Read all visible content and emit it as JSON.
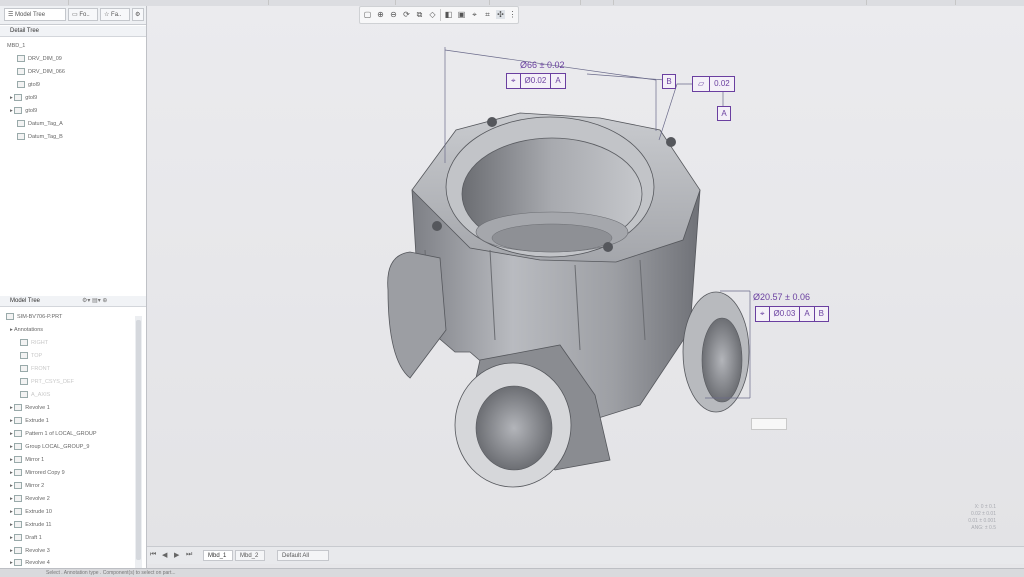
{
  "tabs": {
    "model_tree": "Model Tree",
    "folder": "Fo..",
    "favorites": "Fa.."
  },
  "detail_tree": {
    "header": "Detail Tree",
    "items": [
      "MBD_1",
      "DRV_DIM_09",
      "DRV_DIM_066",
      "gtol9",
      "gtol9",
      "gtol9",
      "Datum_Tag_A",
      "Datum_Tag_B"
    ]
  },
  "model_tree": {
    "header": "Model Tree",
    "items": [
      "SIM-BV706-P.PRT",
      "Annotations",
      "RIGHT",
      "TOP",
      "FRONT",
      "PRT_CSYS_DEF",
      "A_AXIS",
      "Revolve 1",
      "Extrude 1",
      "Pattern 1 of LOCAL_GROUP",
      "Group LOCAL_GROUP_9",
      "Mirror 1",
      "Mirrored Copy 9",
      "Mirror 2",
      "Revolve 2",
      "Extrude 10",
      "Extrude 11",
      "Draft 1",
      "Revolve 3",
      "Revolve 4"
    ]
  },
  "annotations": {
    "dim_top": "Ø66 ± 0.02",
    "fcf_top_value": "Ø0.02",
    "fcf_top_datum": "A",
    "datum_b": "B",
    "flatness_value": "0.02",
    "datum_a": "A",
    "dim_right": "Ø20.57 ± 0.06",
    "fcf_right_value": "Ø0.03",
    "fcf_right_datum1": "A",
    "fcf_right_datum2": "B"
  },
  "bottom": {
    "tab1": "Mbd_1",
    "tab2": "Mbd_2",
    "view": "Default All"
  },
  "coords": {
    "line1": "X: 0 ± 0.1",
    "line2": "0.02 ± 0.01",
    "line3": "0.01 ± 0.001",
    "line4": "ANG: ± 0.5"
  },
  "status": "Select . Annotation type . Component(s) to select on part...",
  "colors": {
    "annotation": "#6a3fa0",
    "model": "#8c8e94"
  }
}
